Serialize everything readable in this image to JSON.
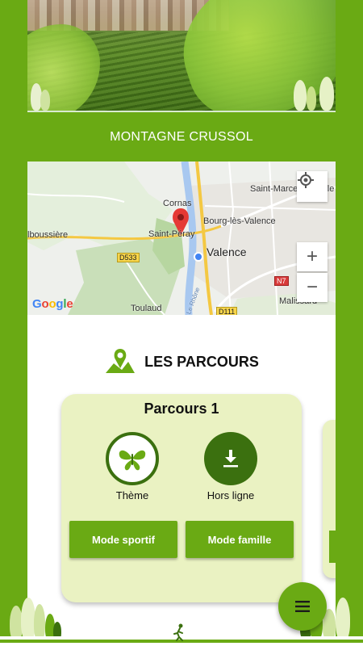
{
  "header": {
    "site_title": "MONTAGNE CRUSSOL"
  },
  "map": {
    "places": {
      "cornas": "Cornas",
      "saint_peray": "Saint-Péray",
      "bourg_les_valence": "Bourg-lès-Valence",
      "valence": "Valence",
      "saint_marcel": "Saint-Marcel-lès-Vale",
      "alboussiere": "lboussière",
      "toulaud": "Toulaud",
      "malissard": "Malissard",
      "rhone": "Le Rhône"
    },
    "roads": {
      "d533": "D533",
      "n7": "N7",
      "d111": "D111"
    },
    "zoom_in_label": "+",
    "zoom_out_label": "−",
    "attribution": "Google"
  },
  "section": {
    "title": "LES PARCOURS",
    "icon": "map-pin-icon"
  },
  "cards": [
    {
      "title": "Parcours 1",
      "theme_label": "Thème",
      "offline_label": "Hors ligne",
      "sport_mode_label": "Mode sportif",
      "family_mode_label": "Mode famille"
    }
  ],
  "fab": {
    "icon": "menu-icon"
  },
  "colors": {
    "primary_green": "#6aaa14",
    "dark_green": "#3b700f",
    "card_bg": "#eaf2c2",
    "marker_red": "#e53935"
  }
}
